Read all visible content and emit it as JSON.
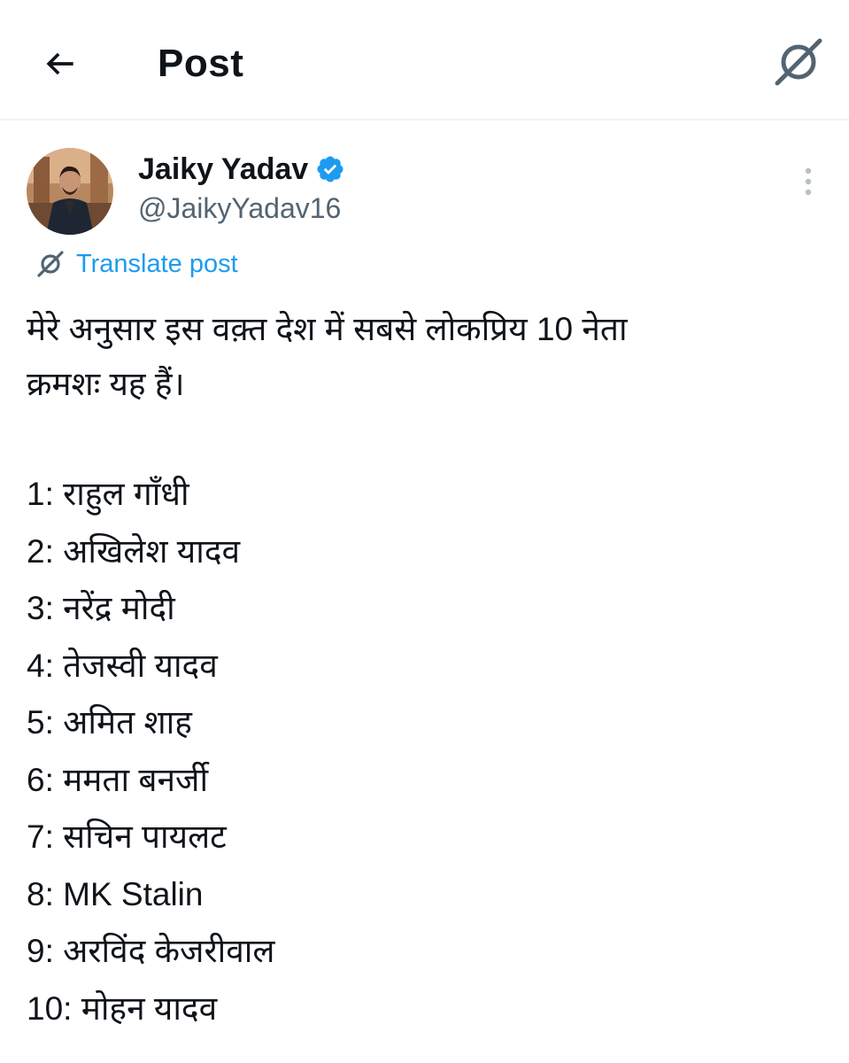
{
  "header": {
    "title": "Post",
    "back_icon": "back-arrow-icon",
    "translate_icon": "translate-icon"
  },
  "author": {
    "display_name": "Jaiky Yadav",
    "handle": "@JaikyYadav16",
    "verified": true,
    "verified_color": "#1d9bf0"
  },
  "translate": {
    "label": "Translate post",
    "color": "#1d9bf0"
  },
  "post": {
    "intro_lines": [
      "मेरे अनुसार इस वक़्त देश में सबसे लोकप्रिय 10 नेता",
      "क्रमशः यह हैं।"
    ],
    "list": [
      "1: राहुल गाँधी",
      "2: अखिलेश यादव",
      "3: नरेंद्र मोदी",
      "4: तेजस्वी यादव",
      "5: अमित शाह",
      "6: ममता बनर्जी",
      "7: सचिन पायलट",
      "8: MK Stalin",
      "9: अरविंद केजरीवाल",
      "10: मोहन यादव"
    ]
  },
  "colors": {
    "text": "#0f1419",
    "secondary": "#536471",
    "divider": "#eff3f4"
  }
}
